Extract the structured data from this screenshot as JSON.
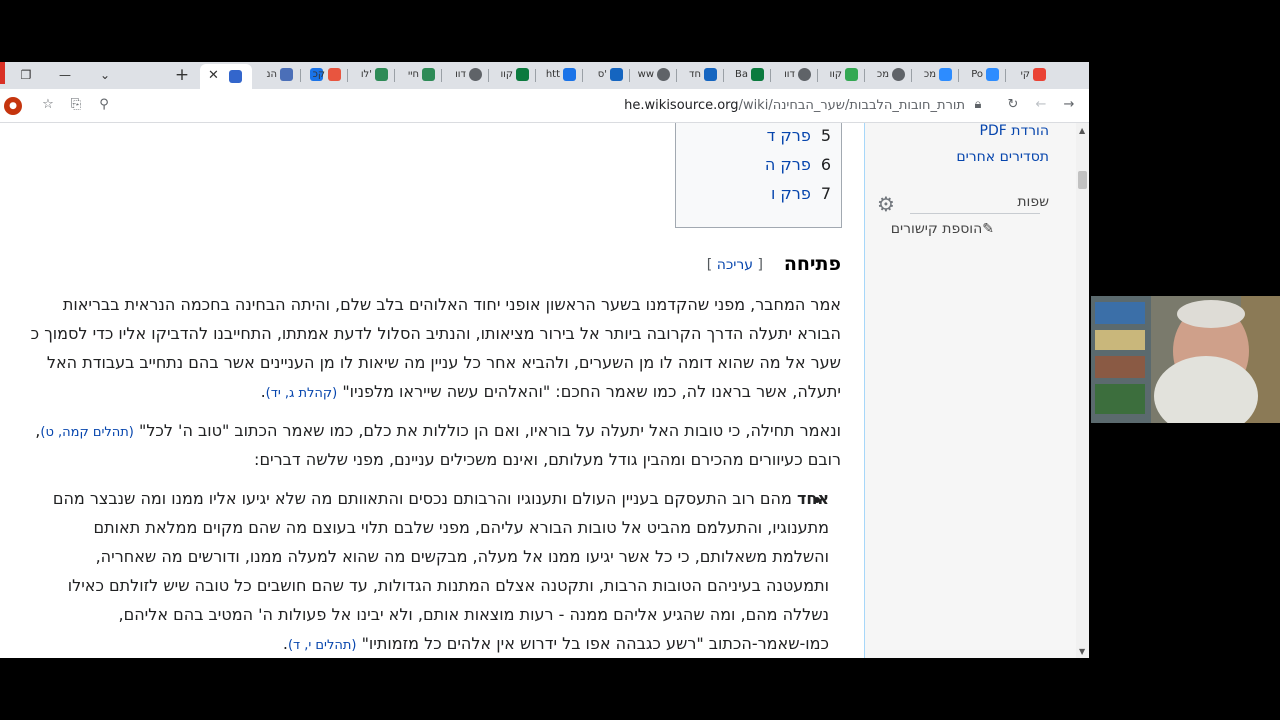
{
  "tabs": [
    {
      "label": "הנ"
    },
    {
      "label": ""
    },
    {
      "label": "קכ"
    },
    {
      "label": "לו'"
    },
    {
      "label": "חיי"
    },
    {
      "label": "דוו"
    },
    {
      "label": "קוו"
    },
    {
      "label": "htt"
    },
    {
      "label": "ס'"
    },
    {
      "label": "ww"
    },
    {
      "label": "חד"
    },
    {
      "label": "Ba"
    },
    {
      "label": "דוו"
    },
    {
      "label": "קוו"
    },
    {
      "label": "מכ"
    },
    {
      "label": "מכ"
    },
    {
      "label": "Po"
    },
    {
      "label": "קי"
    }
  ],
  "address": {
    "domain": "he.wikisource.org",
    "path": "/wiki/תורת_חובות_הלבבות/שער_הבחינה"
  },
  "sidebar": {
    "pdf": "הורדת PDF",
    "other": "תסדירים אחרים",
    "languages": "שפות",
    "add_links": "הוספת קישורים"
  },
  "toc": [
    {
      "num": "5",
      "label": "פרק ד"
    },
    {
      "num": "6",
      "label": "פרק ה"
    },
    {
      "num": "7",
      "label": "פרק ו"
    }
  ],
  "section": {
    "title": "פתיחה",
    "edit_open": "[ ",
    "edit": "עריכה",
    "edit_close": " ]"
  },
  "para1": [
    "אמר המחבר, מפני שהקדמנו בשער הראשון אופני יחוד האלוהים בלב שלם, והיתה הבחינה בחכמה הנראית בבריאות",
    "הבורא יתעלה הדרך הקרובה ביותר אל בירור מציאותו, והנתיב הסלול לדעת אמתתו, התחייבנו להדביקו אליו כדי לסמוך כ",
    "שער אל מה שהוא דומה לו מן השערים, ולהביא אחר כל עניין מה שיאות לו מן העניינים אשר בהם נתחייב בעבודת האל",
    "יתעלה, אשר בראנו לה, כמו שאמר החכם: \"והאלהים עשה שייראו מלפניו\""
  ],
  "para1_ref": "(קהלת ג, יד)",
  "para2_a": "ונאמר תחילה, כי טובות האל יתעלה על בוראיו, ואם הן כוללות את כלם, כמו שאמר הכתוב \"טוב ה' לכל\"",
  "para2_ref": "(תהלים קמה, ט)",
  "para2_b": "רובם כעיוורים מהכירם ומהבין גודל מעלותם, ואינם משכילים עניינם, מפני שלשה דברים:",
  "bullet": {
    "bold": "אחד",
    "lines": [
      " מהם רוב התעסקם בעניין העולם ותענוגיו והרבותם נכסים והתאוותם מה שלא יגיעו אליו ממנו ומה שנבצר מהם",
      "מתענוגיו, והתעלמם מהביט אל טובות הבורא עליהם, מפני שלבם תלוי בעוצם מה שהם מקוים ממלאת תאותם",
      "והשלמת משאלותם, כי כל אשר יגיעו ממנו אל מעלה, מבקשים מה שהוא למעלה ממנו, ודורשים מה שאחריה,",
      "ותמעטנה בעיניהם הטובות הרבות, ותקטנה אצלם המתנות הגדולות, עד שהם חושבים כל טובה שיש לזולתם כאילו",
      "נשללה מהם, ומה שהגיע אליהם ממנה - רעות מוצאות אותם, ולא יבינו אל פעולות ה' המטיב בהם אליהם,",
      "כמו-שאמר-הכתוב \"רשע כגבהה אפו בל ידרוש אין אלהים כל מזמותיו\""
    ],
    "ref": "(תהלים י, ד)"
  },
  "colors": {
    "link": "#0645ad",
    "text": "#202122",
    "sidebar_bg": "#f6f6f6"
  }
}
